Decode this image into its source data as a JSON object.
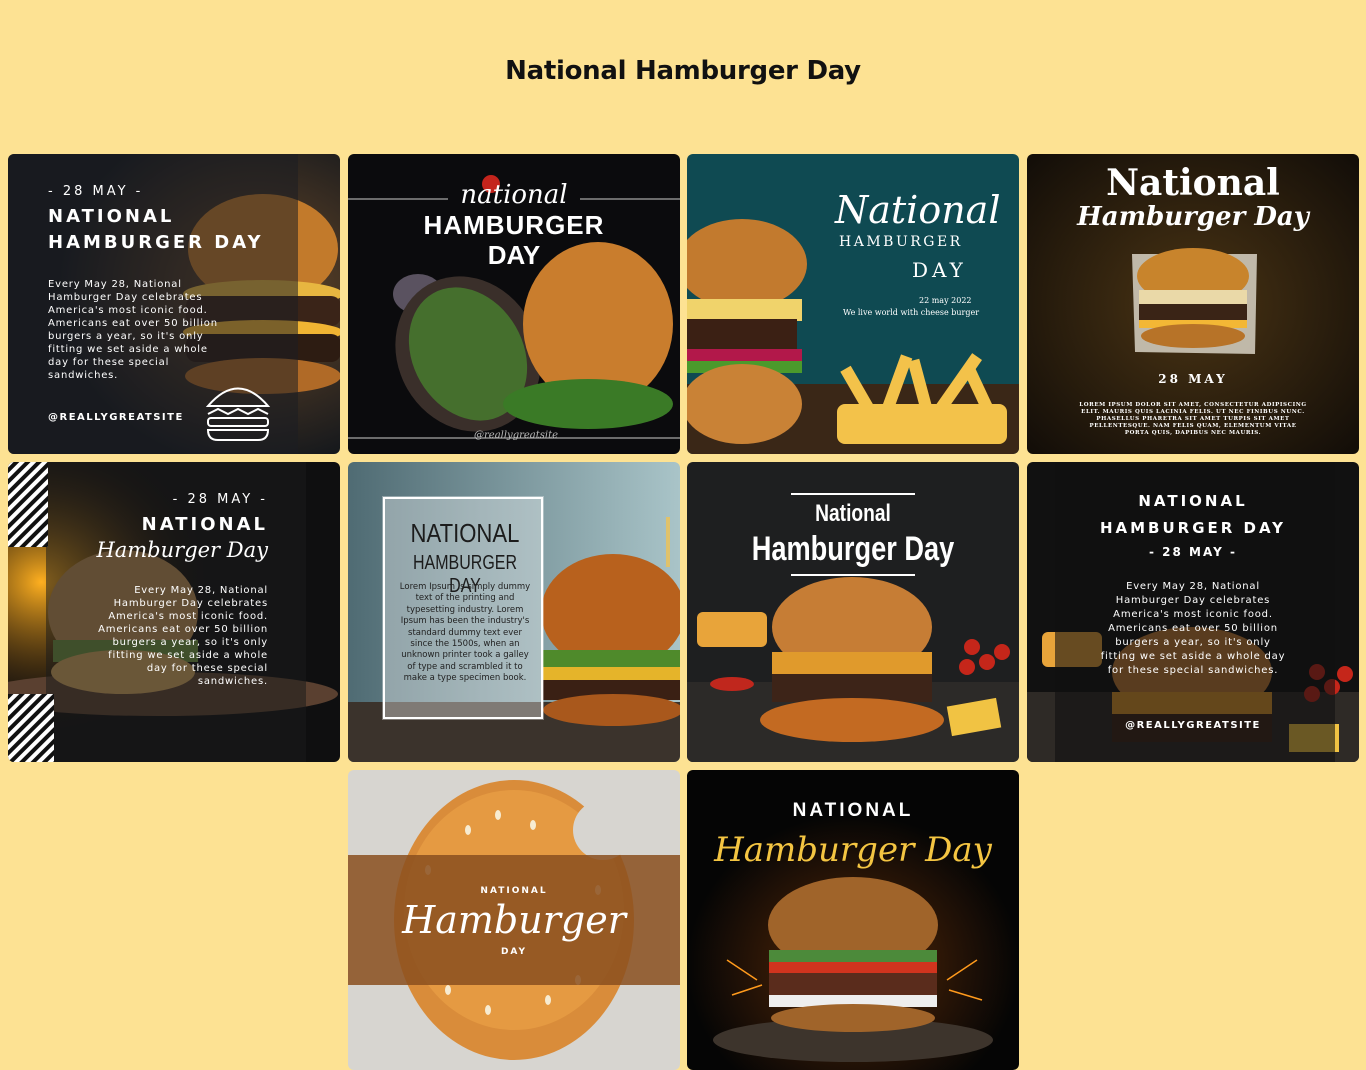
{
  "page": {
    "title": "National Hamburger Day"
  },
  "cards": [
    {
      "date": "- 28 MAY -",
      "title_line1": "NATIONAL",
      "title_line2": "HAMBURGER DAY",
      "body": "Every May 28, National Hamburger Day celebrates America's most iconic food. Americans eat over 50 billion burgers a year, so it's only fitting we set aside a whole day for these special sandwiches.",
      "handle": "@REALLYGREATSITE",
      "icon": "burger-outline-icon"
    },
    {
      "script_word": "national",
      "line1": "HAMBURGER",
      "line2": "DAY",
      "handle": "@reallygreatsite"
    },
    {
      "script_word": "National",
      "line1": "HAMBURGER",
      "line2": "DAY",
      "date": "22 may 2022",
      "tagline": "We live world with cheese burger"
    },
    {
      "line1": "National",
      "script_line": "Hamburger Day",
      "date": "28 MAY",
      "body": "LOREM IPSUM DOLOR SIT AMET, CONSECTETUR ADIPISCING ELIT. MAURIS QUIS LACINIA FELIS. UT NEC FINIBUS NUNC. PHASELLUS PHARETRA SIT AMET TURPIS SIT AMET PELLENTESQUE. NAM FELIS QUAM, ELEMENTUM VITAE PORTA QUIS, DAPIBUS NEC MAURIS."
    },
    {
      "date": "- 28 MAY -",
      "line1": "NATIONAL",
      "script_line": "Hamburger Day",
      "body": "Every May 28, National Hamburger Day celebrates America's most iconic food. Americans eat over 50 billion burgers a year, so it's only fitting we set aside a whole day for these special sandwiches."
    },
    {
      "line1": "NATIONAL",
      "line2": "HAMBURGER DAY",
      "body": "Lorem Ipsum is simply dummy text of the printing and typesetting industry. Lorem Ipsum has been the industry's standard dummy text ever since the 1500s, when an unknown printer took a galley of type and scrambled it to make a type specimen book."
    },
    {
      "line1": "National",
      "line2": "Hamburger Day"
    },
    {
      "line1": "NATIONAL",
      "line2": "HAMBURGER DAY",
      "date": "- 28 MAY -",
      "body": "Every May 28, National Hamburger Day celebrates America's most iconic food. Americans eat over 50 billion burgers a year, so it's only fitting we set aside a whole day for these special sandwiches.",
      "handle": "@REALLYGREATSITE"
    },
    {
      "line1": "NATIONAL",
      "script_line": "Hamburger",
      "line2": "DAY"
    },
    {
      "line1": "NATIONAL",
      "script_line": "Hamburger Day"
    }
  ],
  "colors": {
    "background": "#fde293",
    "accent_yellow": "#f4c542",
    "band_brown": "#8a4f1f"
  }
}
